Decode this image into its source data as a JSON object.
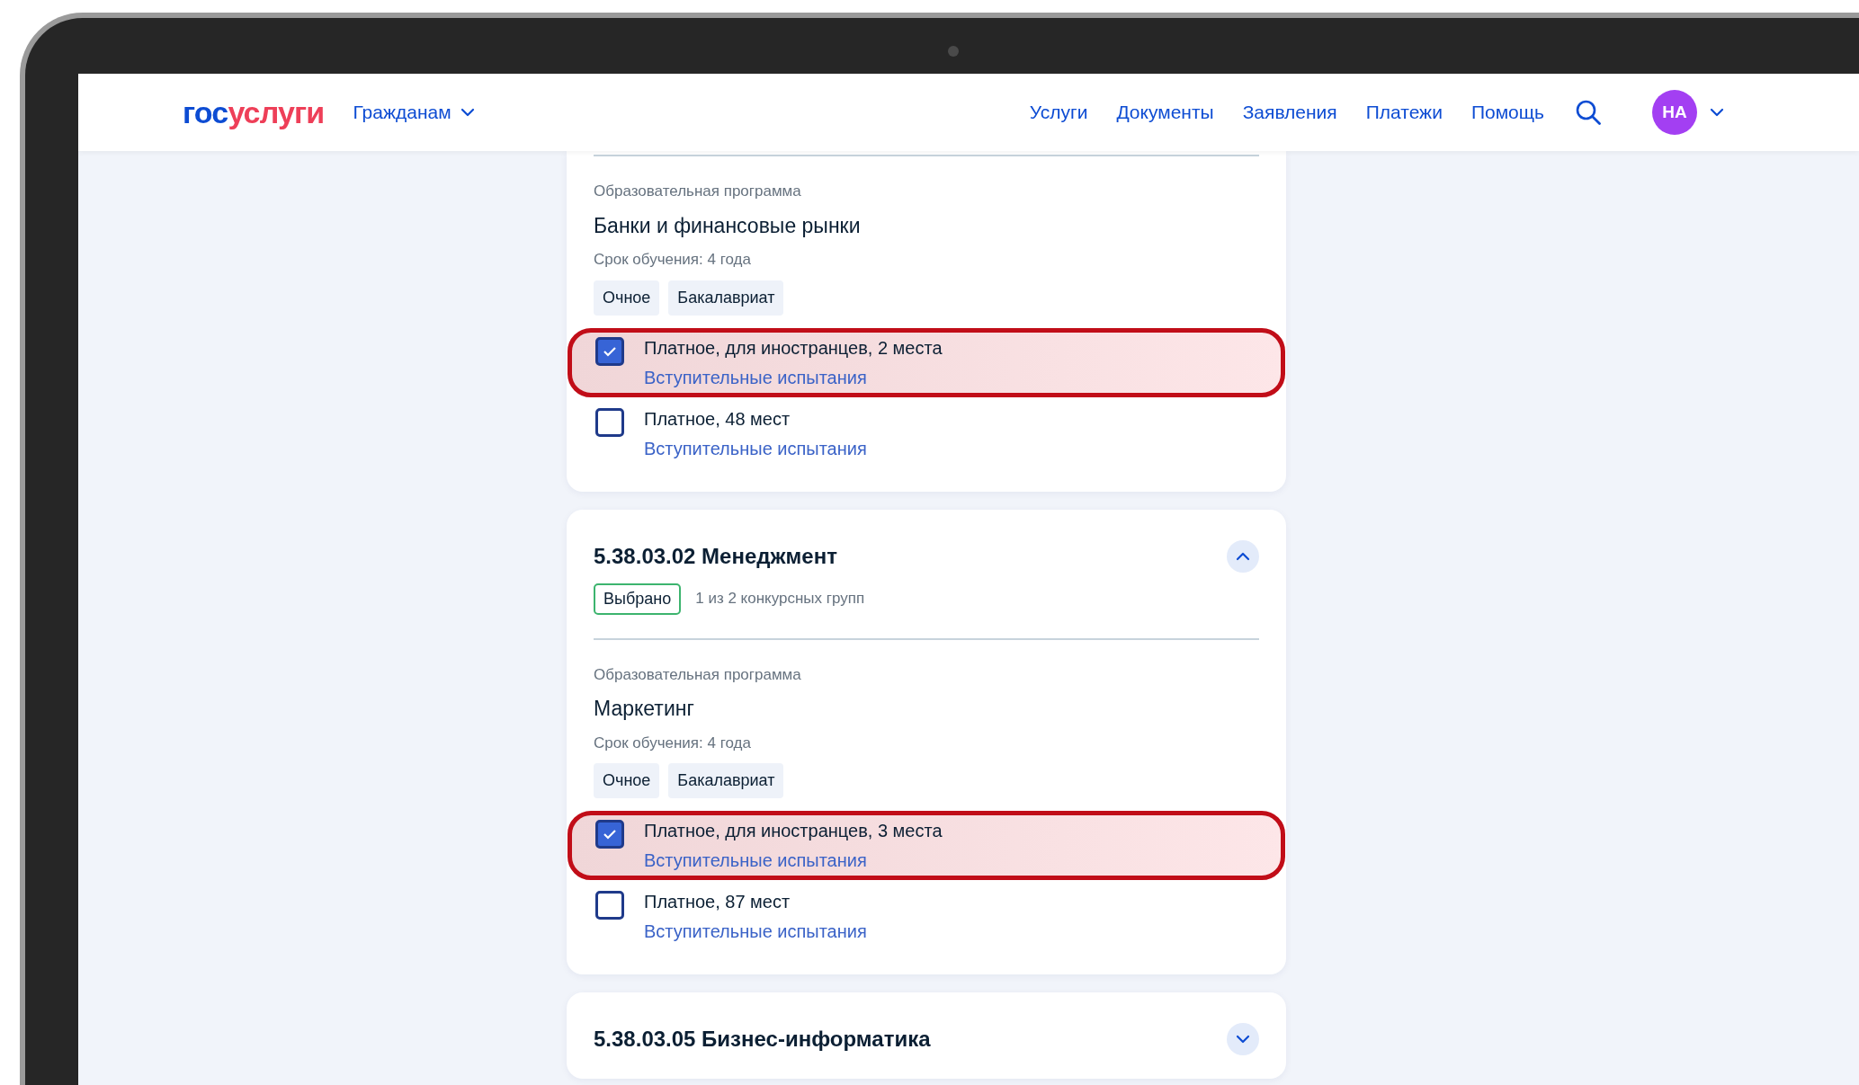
{
  "header": {
    "logo": {
      "part_1": "гос",
      "part_2": "услуги"
    },
    "audience_menu": "Гражданам",
    "nav": [
      "Услуги",
      "Документы",
      "Заявления",
      "Платежи",
      "Помощь"
    ],
    "avatar": "НА"
  },
  "cards": [
    {
      "programs": [
        {
          "label": "Образовательная программа",
          "name": "Банки и финансовые рынки",
          "duration": "Срок обучения: 4 года",
          "tags": [
            "Очное",
            "Бакалавриат"
          ],
          "options": [
            {
              "label": "Платное, для иностранцев, 2 места",
              "link": "Вступительные испытания",
              "checked": true,
              "highlighted": true
            },
            {
              "label": "Платное, 48 мест",
              "link": "Вступительные испытания",
              "checked": false,
              "highlighted": false
            }
          ]
        }
      ]
    },
    {
      "title": "5.38.03.02 Менеджмент",
      "expanded": true,
      "badge": "Выбрано",
      "count": "1 из 2 конкурсных групп",
      "programs": [
        {
          "label": "Образовательная программа",
          "name": "Маркетинг",
          "duration": "Срок обучения: 4 года",
          "tags": [
            "Очное",
            "Бакалавриат"
          ],
          "options": [
            {
              "label": "Платное, для иностранцев, 3 места",
              "link": "Вступительные испытания",
              "checked": true,
              "highlighted": true
            },
            {
              "label": "Платное, 87 мест",
              "link": "Вступительные испытания",
              "checked": false,
              "highlighted": false
            }
          ]
        }
      ]
    },
    {
      "title": "5.38.03.05 Бизнес-информатика",
      "expanded": false
    }
  ]
}
